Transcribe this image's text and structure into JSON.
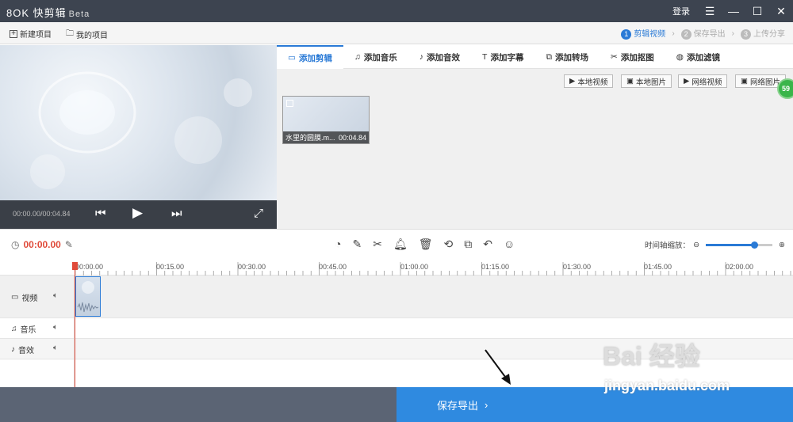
{
  "app": {
    "logo": "8OK",
    "name": "快剪辑",
    "edition": "Beta",
    "login": "登录"
  },
  "toolbar": {
    "new_project": "新建项目",
    "my_projects": "我的项目"
  },
  "steps": [
    {
      "num": "1",
      "label": "剪辑视频",
      "active": true
    },
    {
      "num": "2",
      "label": "保存导出",
      "active": false
    },
    {
      "num": "3",
      "label": "上传分享",
      "active": false
    }
  ],
  "player": {
    "timecode": "00:00.00/00:04.84"
  },
  "tabs": [
    {
      "label": "添加剪辑",
      "icon": "video-camera-icon"
    },
    {
      "label": "添加音乐",
      "icon": "music-icon"
    },
    {
      "label": "添加音效",
      "icon": "sound-effect-icon"
    },
    {
      "label": "添加字幕",
      "icon": "text-icon"
    },
    {
      "label": "添加转场",
      "icon": "transition-icon"
    },
    {
      "label": "添加抠图",
      "icon": "cutout-icon"
    },
    {
      "label": "添加滤镜",
      "icon": "filter-icon"
    }
  ],
  "media_buttons": [
    "本地视频",
    "本地图片",
    "网络视频",
    "网络图片"
  ],
  "clip": {
    "name": "水里的圆膜.m...",
    "duration": "00:04.84"
  },
  "badge": "59",
  "edit": {
    "current_time": "00:00.00",
    "zoom_label": "时间轴缩放：",
    "zoom_level": 0.72
  },
  "ruler": [
    "00:00.00",
    "00:15.00",
    "00:30.00",
    "00:45.00",
    "01:00.00",
    "01:15.00",
    "01:30.00",
    "01:45.00",
    "02:00.00"
  ],
  "tracks": {
    "video": "视频",
    "music": "音乐",
    "sfx": "音效"
  },
  "save_export": "保存导出",
  "watermark": {
    "line1": "Bai 经验",
    "line2": "jingyan.baidu.com"
  },
  "colors": {
    "accent": "#2a7ad6",
    "playhead": "#e04b3a",
    "save": "#2f8ae0"
  }
}
